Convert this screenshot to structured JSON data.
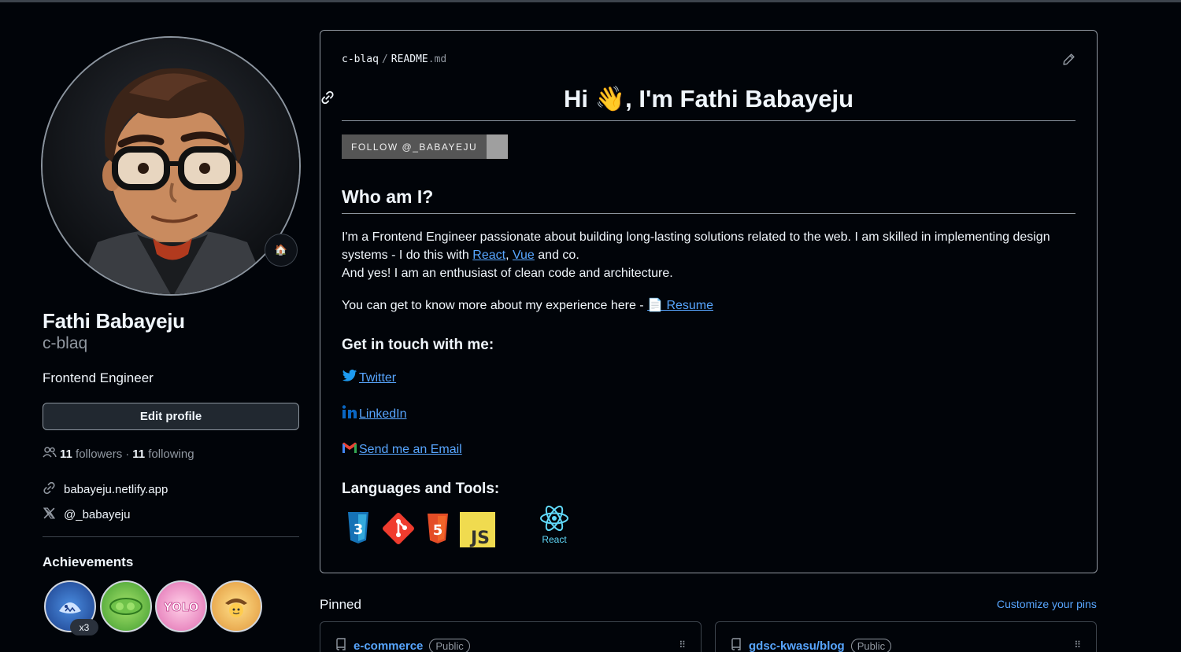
{
  "profile": {
    "full_name": "Fathi Babayeju",
    "username": "c-blaq",
    "bio": "Frontend Engineer",
    "edit_label": "Edit profile",
    "followers_count": "11",
    "followers_label": "followers",
    "separator": "·",
    "following_count": "11",
    "following_label": "following",
    "website": "babayeju.netlify.app",
    "x_handle": "@_babayeju",
    "status_emoji": "🏠"
  },
  "achievements": {
    "title": "Achievements",
    "count_label": "x3"
  },
  "readme": {
    "path_owner": "c-blaq",
    "path_slash": "/",
    "path_file": "README",
    "path_ext": ".md",
    "title": "Hi 👋, I'm Fathi Babayeju",
    "follow_badge": "FOLLOW @_BABAYEJU",
    "who_heading": "Who am I?",
    "intro_1": "I'm a Frontend Engineer passionate about building long-lasting solutions related to the web. I am skilled in implementing design systems - I do this with ",
    "react_link": "React",
    "comma": ", ",
    "vue_link": "Vue",
    "intro_2": " and co.",
    "intro_3": "And yes! I am an enthusiast of clean code and architecture.",
    "resume_text": "You can get to know more about my experience here - ",
    "resume_icon": "📄",
    "resume_link": " Resume",
    "touch_heading": "Get in touch with me:",
    "twitter": " Twitter",
    "linkedin": " LinkedIn",
    "email": " Send me an Email",
    "tools_heading": "Languages and Tools:",
    "tools": [
      "css3",
      "git",
      "html5",
      "javascript",
      "react"
    ],
    "react_caption": "React",
    "js_label": "JS",
    "css_label": "3",
    "html_label": "5"
  },
  "pinned": {
    "title": "Pinned",
    "customize": "Customize your pins",
    "repos": [
      {
        "name": "e-commerce",
        "visibility": "Public"
      },
      {
        "name": "gdsc-kwasu/blog",
        "visibility": "Public"
      }
    ],
    "drag_glyph": "⠿"
  },
  "colors": {
    "background": "#010409",
    "link": "#58a6ff",
    "muted": "#9198a1",
    "border": "#3d444d"
  }
}
